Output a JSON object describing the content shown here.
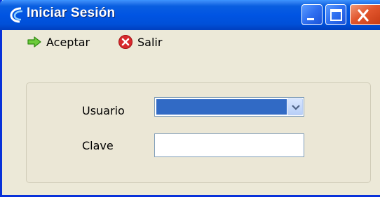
{
  "window": {
    "title": "Iniciar Sesión",
    "colors": {
      "titlebar": "#0054e3",
      "close_button": "#e2562d",
      "body": "#ece9d8"
    }
  },
  "toolbar": {
    "accept_label": "Aceptar",
    "accept_icon": "green-arrow-right-icon",
    "exit_label": "Salir",
    "exit_icon": "red-x-circle-icon"
  },
  "form": {
    "user_label": "Usuario",
    "user_value": "",
    "password_label": "Clave",
    "password_value": ""
  }
}
